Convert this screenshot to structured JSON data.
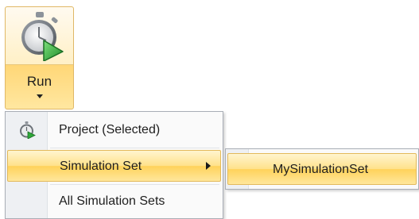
{
  "run_button": {
    "label": "Run",
    "icon": "stopwatch-play-icon",
    "dropdown_icon": "chevron-down-icon"
  },
  "menu": {
    "items": [
      {
        "label": "Project (Selected)",
        "icon": "stopwatch-play-icon"
      },
      {
        "label": "Simulation Set",
        "icon": "",
        "submenu_arrow": "chevron-right-icon"
      },
      {
        "label": "All Simulation Sets",
        "icon": ""
      }
    ]
  },
  "submenu": {
    "items": [
      {
        "label": "MySimulationSet"
      }
    ]
  },
  "colors": {
    "highlight": "#ffd25a",
    "highlight_border": "#e3b95a",
    "menu_border": "#a9aeb6",
    "play_green": "#2fa83a"
  }
}
